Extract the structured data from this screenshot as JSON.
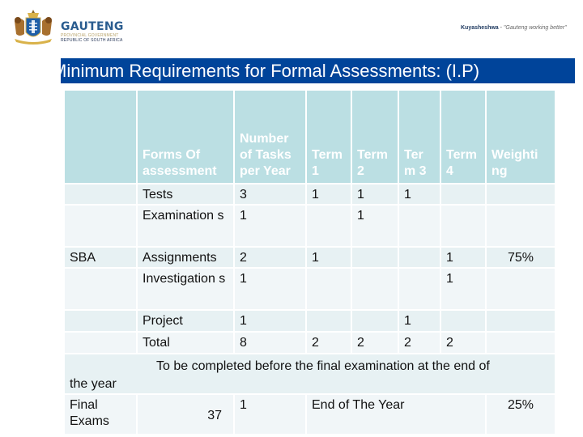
{
  "header": {
    "brand_name": "GAUTENG",
    "brand_line1": "PROVINCIAL GOVERNMENT",
    "brand_line2": "REPUBLIC OF SOUTH AFRICA",
    "motto_bold": "Kuyasheshwa",
    "motto_sep": " - ",
    "motto_italic": "\"Gauteng working better\""
  },
  "title": "Minimum Requirements for Formal Assessments: (I.P)",
  "table": {
    "headers": [
      "",
      "Forms Of assessment",
      "Number of Tasks per Year",
      "Term 1",
      "Term 2",
      "Ter m 3",
      "Term 4",
      "Weighti ng"
    ],
    "rows": [
      {
        "category": "",
        "form": "Tests",
        "tasks": "3",
        "t1": "1",
        "t2": "1",
        "t3": "1",
        "t4": "",
        "weighting": ""
      },
      {
        "category": "",
        "form": "Examination s",
        "tasks": "1",
        "t1": "",
        "t2": "1",
        "t3": "",
        "t4": "",
        "weighting": ""
      },
      {
        "category": "SBA",
        "form": "Assignments",
        "tasks": "2",
        "t1": "1",
        "t2": "",
        "t3": "",
        "t4": "1",
        "weighting": "75%"
      },
      {
        "category": "",
        "form": "Investigation s",
        "tasks": "1",
        "t1": "",
        "t2": "",
        "t3": "",
        "t4": "1",
        "weighting": ""
      },
      {
        "category": "",
        "form": "Project",
        "tasks": "1",
        "t1": "",
        "t2": "",
        "t3": "1",
        "t4": "",
        "weighting": ""
      },
      {
        "category": "",
        "form": "Total",
        "tasks": "8",
        "t1": "2",
        "t2": "2",
        "t3": "2",
        "t4": "2",
        "weighting": ""
      }
    ],
    "note_lead": "To be completed before the final examination at the end of",
    "note_tail": "the year",
    "final_row": {
      "category": "Final Exams",
      "number": "37",
      "tasks": "1",
      "period": "End of The Year",
      "weighting": "25%"
    }
  },
  "colors": {
    "title_bar": "#00449a",
    "header_cell": "#bbdfe3",
    "row_odd": "#e7f1f3",
    "row_even": "#f1f6f8"
  }
}
